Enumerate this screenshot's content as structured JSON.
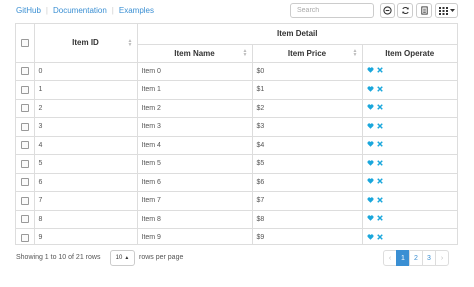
{
  "links": {
    "github": "GitHub",
    "documentation": "Documentation",
    "examples": "Examples"
  },
  "toolbar": {
    "search_placeholder": "Search"
  },
  "table": {
    "group_header": "Item Detail",
    "columns": {
      "id": "Item ID",
      "name": "Item Name",
      "price": "Item Price",
      "operate": "Item Operate"
    },
    "rows": [
      {
        "id": "0",
        "name": "Item 0",
        "price": "$0"
      },
      {
        "id": "1",
        "name": "Item 1",
        "price": "$1"
      },
      {
        "id": "2",
        "name": "Item 2",
        "price": "$2"
      },
      {
        "id": "3",
        "name": "Item 3",
        "price": "$3"
      },
      {
        "id": "4",
        "name": "Item 4",
        "price": "$4"
      },
      {
        "id": "5",
        "name": "Item 5",
        "price": "$5"
      },
      {
        "id": "6",
        "name": "Item 6",
        "price": "$6"
      },
      {
        "id": "7",
        "name": "Item 7",
        "price": "$7"
      },
      {
        "id": "8",
        "name": "Item 8",
        "price": "$8"
      },
      {
        "id": "9",
        "name": "Item 9",
        "price": "$9"
      }
    ],
    "operate_icons": [
      "heart-icon",
      "close-icon"
    ]
  },
  "footer": {
    "showing": "Showing 1 to 10 of 21 rows",
    "page_size": "10",
    "rows_per_page": "rows per page"
  },
  "pagination": {
    "prev": "‹",
    "pages": [
      "1",
      "2",
      "3"
    ],
    "next": "›",
    "active": "1"
  },
  "colors": {
    "accent": "#3a8fd3",
    "operate_icon": "#1aa7dc",
    "border": "#dddddd"
  }
}
